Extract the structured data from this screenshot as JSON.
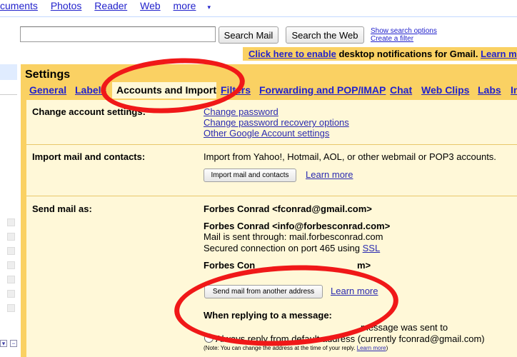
{
  "topnav": {
    "items": [
      "cuments",
      "Photos",
      "Reader",
      "Web"
    ],
    "more": "more"
  },
  "search": {
    "mail_button": "Search Mail",
    "web_button": "Search the Web",
    "options_link": "Show search options",
    "filter_link": "Create a filter"
  },
  "notification": {
    "link": "Click here to enable",
    "text": " desktop notifications for Gmail.",
    "learn": "Learn m"
  },
  "settings": {
    "title": "Settings",
    "tabs": [
      "General",
      "Labels",
      "Accounts and Import",
      "Filters",
      "Forwarding and POP/IMAP",
      "Chat",
      "Web Clips",
      "Labs",
      "In"
    ],
    "active_tab": "Accounts and Import"
  },
  "change_account": {
    "label": "Change account settings:",
    "links": [
      "Change password",
      "Change password recovery options",
      "Other Google Account settings"
    ]
  },
  "import": {
    "label": "Import mail and contacts:",
    "description": "Import from Yahoo!, Hotmail, AOL, or other webmail or POP3 accounts.",
    "button": "Import mail and contacts",
    "learn_more": "Learn more"
  },
  "send_as": {
    "label": "Send mail as:",
    "address1": "Forbes Conrad <fconrad@gmail.com>",
    "address2": "Forbes Conrad <info@forbesconrad.com>",
    "sent_through": "Mail is sent through: mail.forbesconrad.com",
    "secured": "Secured connection on port 465 using ",
    "ssl": "SSL",
    "address3_partial": "Forbes Con",
    "address3_end": "m>",
    "button": "Send mail from another address",
    "learn_more": "Learn more",
    "reply_heading": "When replying to a message:",
    "reply_option1_end": "message was sent to",
    "reply_option2": "Always reply from default address (currently fconrad@gmail.com)",
    "note": "(Note: You can change the address at the time of your reply. ",
    "note_link": "Learn more",
    "note_end": ")"
  },
  "colors": {
    "highlight": "#fad163",
    "panel_bg": "#fff8d8",
    "link": "#2222cc",
    "annotation": "#f01818"
  }
}
